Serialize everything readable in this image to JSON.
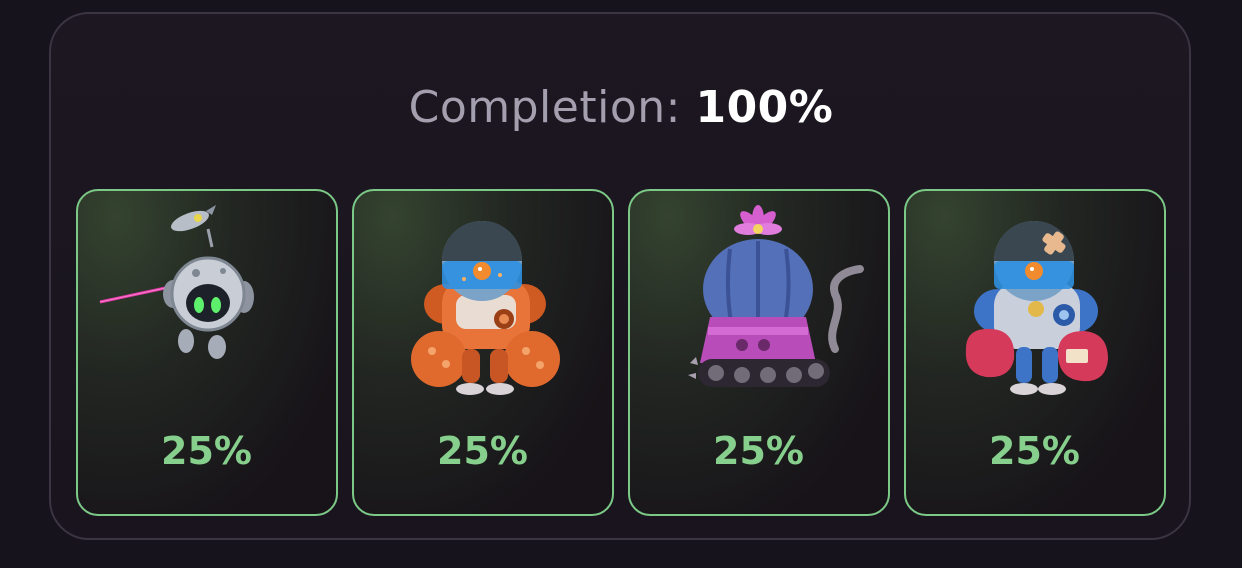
{
  "completion": {
    "label": "Completion:",
    "value": "100%"
  },
  "cards": [
    {
      "name": "drone-robot",
      "percent": "25%",
      "icon": "drone-robot-icon"
    },
    {
      "name": "orange-fishbowl-mech",
      "percent": "25%",
      "icon": "orange-mech-icon"
    },
    {
      "name": "cactus-tank",
      "percent": "25%",
      "icon": "cactus-tank-icon"
    },
    {
      "name": "blue-fishbowl-mech",
      "percent": "25%",
      "icon": "blue-mech-icon"
    }
  ],
  "colors": {
    "accent_green": "#86cf8c",
    "card_border": "#7cc987",
    "panel_border": "#3b3442",
    "background": "#17131c"
  }
}
